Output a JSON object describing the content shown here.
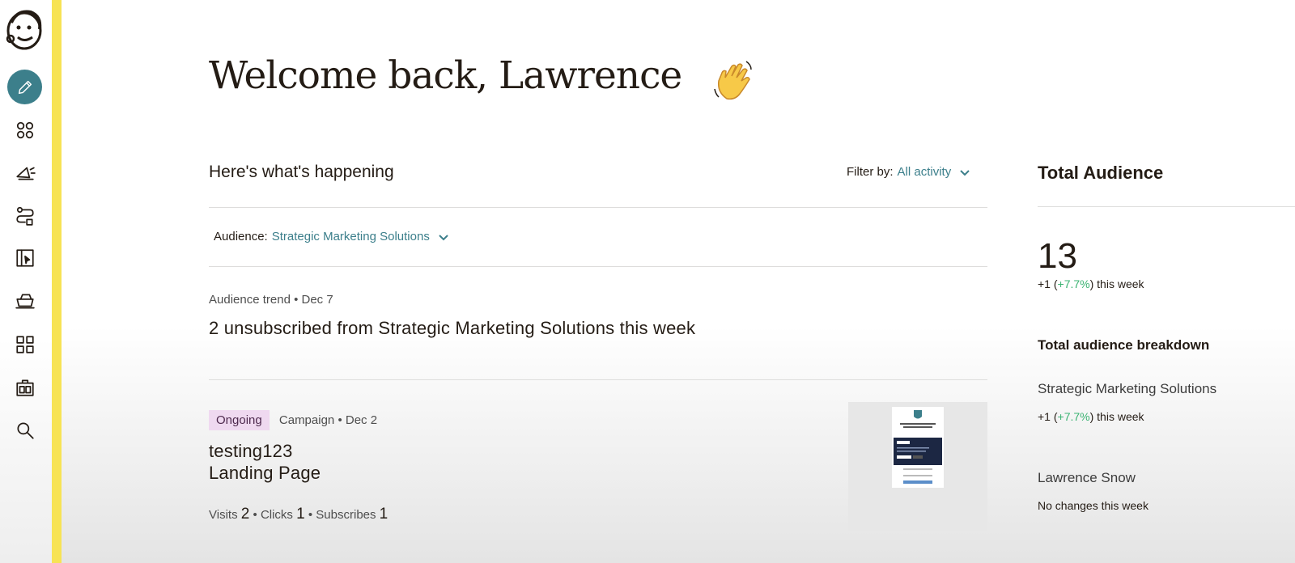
{
  "nav": {
    "items": [
      {
        "icon": "pencil-icon",
        "name": "create"
      },
      {
        "icon": "audience-icon",
        "name": "audience"
      },
      {
        "icon": "campaigns-icon",
        "name": "campaigns"
      },
      {
        "icon": "automations-icon",
        "name": "automations"
      },
      {
        "icon": "website-icon",
        "name": "website"
      },
      {
        "icon": "content-icon",
        "name": "content"
      },
      {
        "icon": "integrations-grid-icon",
        "name": "integrations"
      },
      {
        "icon": "reports-icon",
        "name": "reports"
      },
      {
        "icon": "search-icon",
        "name": "search"
      }
    ],
    "accent_color": "#3c7f8b",
    "stripe_color": "#f7e354"
  },
  "welcome": {
    "title": "Welcome back, Lawrence",
    "emoji": "👋"
  },
  "feed": {
    "title": "Here's what's happening",
    "filter_label": "Filter by:",
    "filter_value": "All activity",
    "audience_label": "Audience:",
    "audience_value": "Strategic Marketing Solutions",
    "items": [
      {
        "type": "Audience trend",
        "date": "• Dec 7",
        "headline": "2 unsubscribed from Strategic Marketing Solutions this week"
      },
      {
        "badge": "Ongoing",
        "type": "Campaign",
        "date": "• Dec 2",
        "headline_line1": "testing123",
        "headline_line2": "Landing Page",
        "stats": {
          "visits_label": "Visits",
          "visits": "2",
          "sep1": "•",
          "clicks_label": "Clicks",
          "clicks": "1",
          "sep2": "•",
          "subscribes_label": "Subscribes",
          "subscribes": "1"
        }
      }
    ]
  },
  "total_audience": {
    "title": "Total Audience",
    "count": "13",
    "delta_prefix": "+1 (",
    "delta_pct": "+7.7%",
    "delta_suffix": ") this week",
    "breakdown_title": "Total audience breakdown",
    "audiences": [
      {
        "name": "Strategic Marketing Solutions",
        "delta_prefix": "+1 (",
        "delta_pct": "+7.7%",
        "delta_suffix": ") this week"
      },
      {
        "name": "Lawrence Snow",
        "note": "No changes this week"
      }
    ]
  }
}
